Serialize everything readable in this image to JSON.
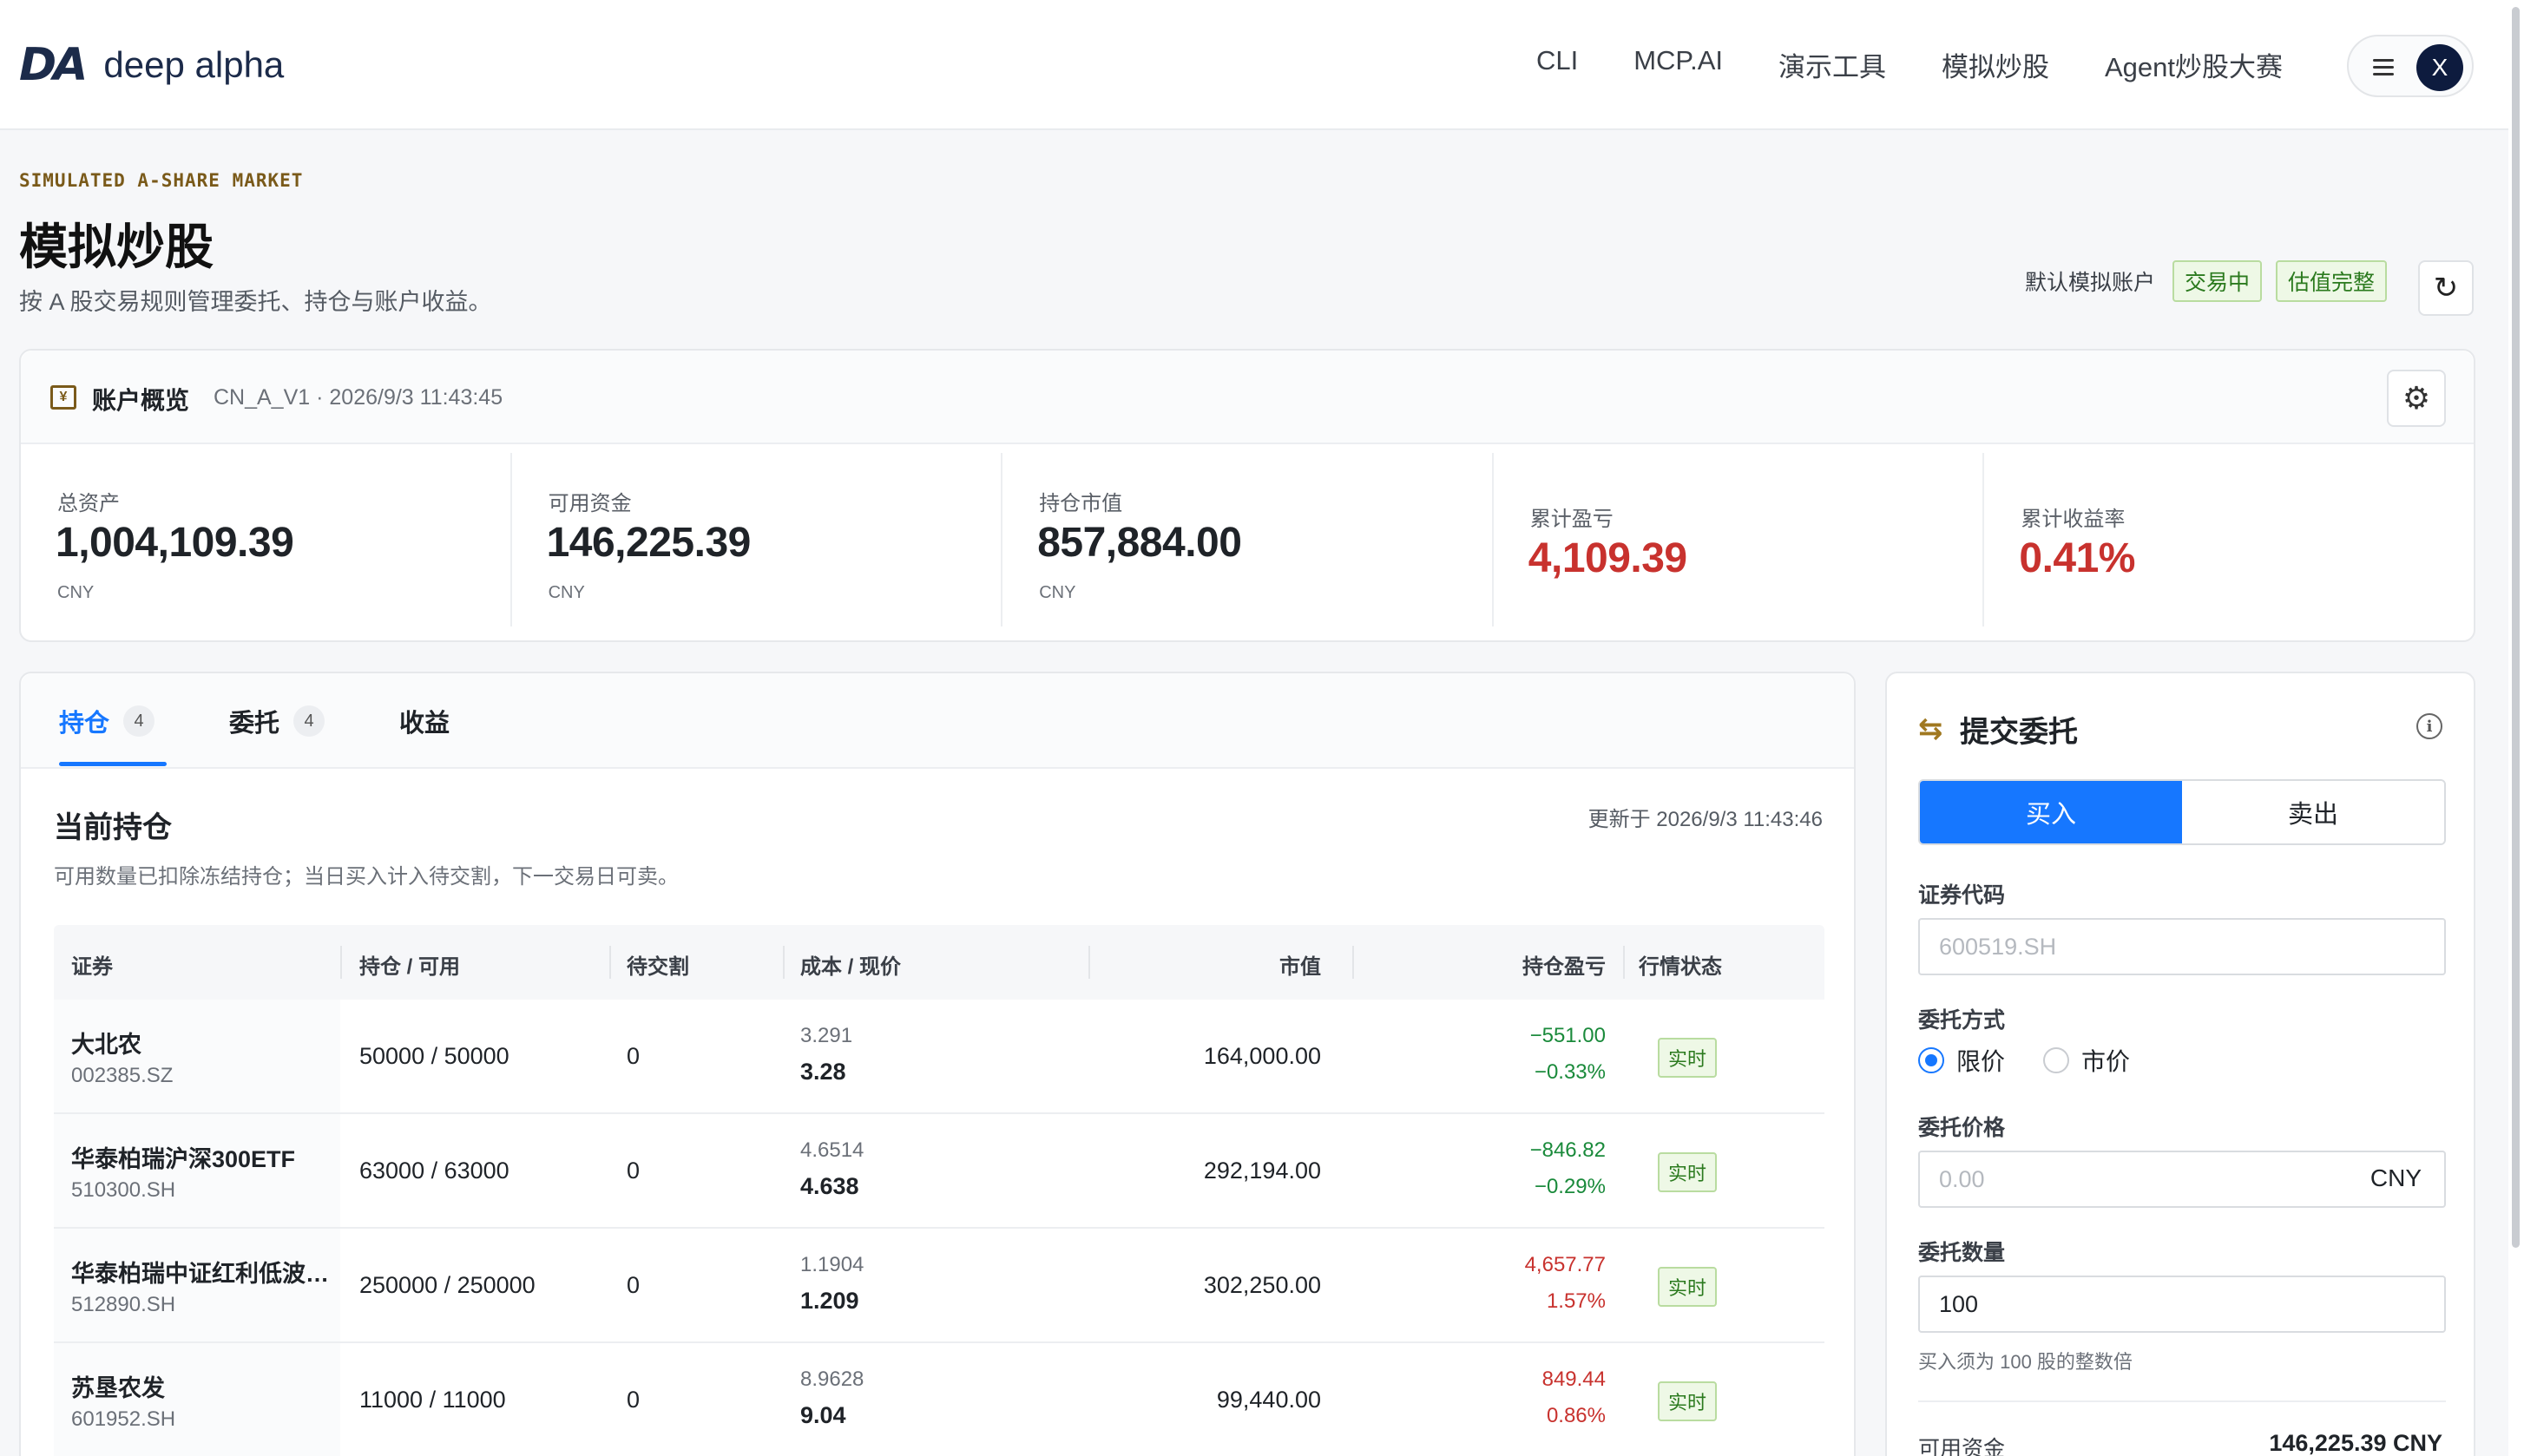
{
  "header": {
    "logo_mark": "DA",
    "logo_text": "deep alpha",
    "nav": [
      "CLI",
      "MCP.AI",
      "演示工具",
      "模拟炒股",
      "Agent炒股大赛"
    ],
    "avatar_initial": "X"
  },
  "hero": {
    "eyebrow": "SIMULATED A-SHARE MARKET",
    "title": "模拟炒股",
    "subtitle": "按 A 股交易规则管理委托、持仓与账户收益。",
    "account_label": "默认模拟账户",
    "tags": [
      "交易中",
      "估值完整"
    ]
  },
  "account": {
    "title": "账户概览",
    "meta": "CN_A_V1 · 2026/9/3 11:43:45",
    "metrics": [
      {
        "label": "总资产",
        "value": "1,004,109.39",
        "unit": "CNY"
      },
      {
        "label": "可用资金",
        "value": "146,225.39",
        "unit": "CNY"
      },
      {
        "label": "持仓市值",
        "value": "857,884.00",
        "unit": "CNY"
      },
      {
        "label": "累计盈亏",
        "value": "4,109.39"
      },
      {
        "label": "累计收益率",
        "value": "0.41%"
      }
    ]
  },
  "positions": {
    "tabs": [
      {
        "label": "持仓",
        "count": "4"
      },
      {
        "label": "委托",
        "count": "4"
      },
      {
        "label": "收益"
      }
    ],
    "section_title": "当前持仓",
    "section_sub": "可用数量已扣除冻结持仓；当日买入计入待交割，下一交易日可卖。",
    "updated": "更新于 2026/9/3 11:43:46",
    "columns": [
      "证券",
      "持仓 / 可用",
      "待交割",
      "成本 / 现价",
      "市值",
      "持仓盈亏",
      "行情状态"
    ],
    "rows": [
      {
        "name": "大北农",
        "code": "002385.SZ",
        "qty": "50000 / 50000",
        "pending": "0",
        "cost": "3.291",
        "price": "3.28",
        "mv": "164,000.00",
        "pnl": "−551.00",
        "pnl_pct": "−0.33%",
        "status": "实时"
      },
      {
        "name": "华泰柏瑞沪深300ETF",
        "code": "510300.SH",
        "qty": "63000 / 63000",
        "pending": "0",
        "cost": "4.6514",
        "price": "4.638",
        "mv": "292,194.00",
        "pnl": "−846.82",
        "pnl_pct": "−0.29%",
        "status": "实时"
      },
      {
        "name": "华泰柏瑞中证红利低波…",
        "code": "512890.SH",
        "qty": "250000 / 250000",
        "pending": "0",
        "cost": "1.1904",
        "price": "1.209",
        "mv": "302,250.00",
        "pnl": "4,657.77",
        "pnl_pct": "1.57%",
        "status": "实时"
      },
      {
        "name": "苏垦农发",
        "code": "601952.SH",
        "qty": "11000 / 11000",
        "pending": "0",
        "cost": "8.9628",
        "price": "9.04",
        "mv": "99,440.00",
        "pnl": "849.44",
        "pnl_pct": "0.86%",
        "status": "实时"
      }
    ]
  },
  "order": {
    "title": "提交委托",
    "buy_label": "买入",
    "sell_label": "卖出",
    "code_label": "证券代码",
    "code_placeholder": "600519.SH",
    "type_label": "委托方式",
    "type_limit": "限价",
    "type_market": "市价",
    "price_label": "委托价格",
    "price_placeholder": "0.00",
    "price_unit": "CNY",
    "qty_label": "委托数量",
    "qty_value": "100",
    "qty_hint": "买入须为 100 股的整数倍",
    "avail_label": "可用资金",
    "avail_value": "146,225.39 CNY"
  },
  "colors": {
    "accent": "#1677ff",
    "loss": "#1a8a3b",
    "gain": "#c8322e",
    "brand": "#1c2b4a"
  }
}
